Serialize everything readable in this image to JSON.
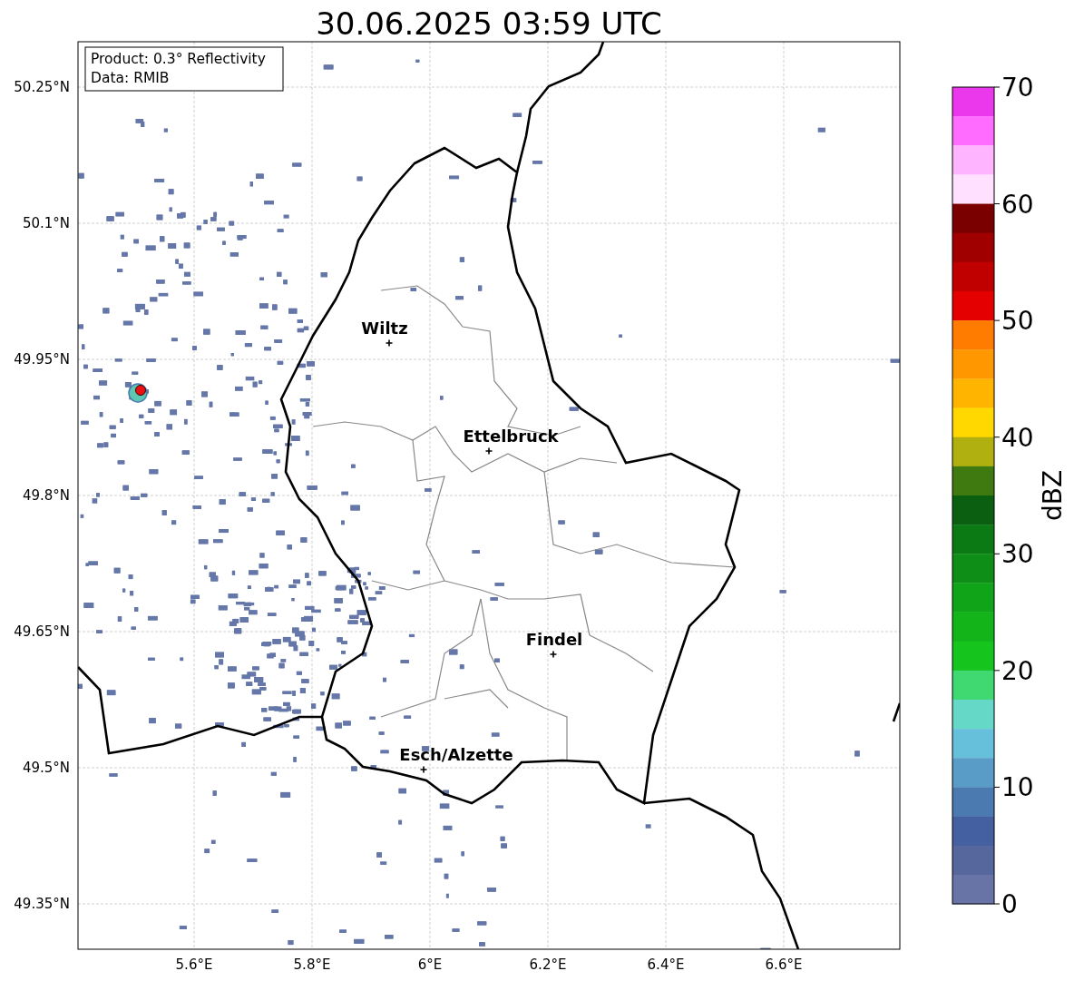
{
  "title": "30.06.2025 03:59 UTC",
  "info_box": [
    "Product: 0.3° Reflectivity",
    "Data: RMIB"
  ],
  "map": {
    "cities": [
      {
        "name": "Wiltz"
      },
      {
        "name": "Ettelbruck"
      },
      {
        "name": "Findel"
      },
      {
        "name": "Esch/Alzette"
      }
    ],
    "lat_labels": [
      "50.25°N",
      "50.1°N",
      "49.95°N",
      "49.8°N",
      "49.65°N",
      "49.5°N",
      "49.35°N"
    ],
    "lon_labels": [
      "5.6°E",
      "5.8°E",
      "6°E",
      "6.2°E",
      "6.4°E",
      "6.6°E"
    ]
  },
  "colorbar": {
    "label": "dBZ",
    "ticks": [
      "70",
      "60",
      "50",
      "40",
      "30",
      "20",
      "10",
      "0"
    ],
    "bins": [
      {
        "color": "#ec38ec"
      },
      {
        "color": "#ff6cff"
      },
      {
        "color": "#ffb4ff"
      },
      {
        "color": "#ffe0ff"
      },
      {
        "color": "#7a0000"
      },
      {
        "color": "#a00000"
      },
      {
        "color": "#c00000"
      },
      {
        "color": "#e40000"
      },
      {
        "color": "#ff7c00"
      },
      {
        "color": "#ff9800"
      },
      {
        "color": "#ffb400"
      },
      {
        "color": "#ffd800"
      },
      {
        "color": "#b0b010"
      },
      {
        "color": "#3f7a10"
      },
      {
        "color": "#0a6010"
      },
      {
        "color": "#0c7a14"
      },
      {
        "color": "#0e8e16"
      },
      {
        "color": "#10a418"
      },
      {
        "color": "#12b41a"
      },
      {
        "color": "#16c41e"
      },
      {
        "color": "#40d870"
      },
      {
        "color": "#66d8c8"
      },
      {
        "color": "#66c0dc"
      },
      {
        "color": "#5a9cc8"
      },
      {
        "color": "#4a7ab0"
      },
      {
        "color": "#4460a0"
      },
      {
        "color": "#56679e"
      },
      {
        "color": "#6874a6"
      }
    ]
  }
}
